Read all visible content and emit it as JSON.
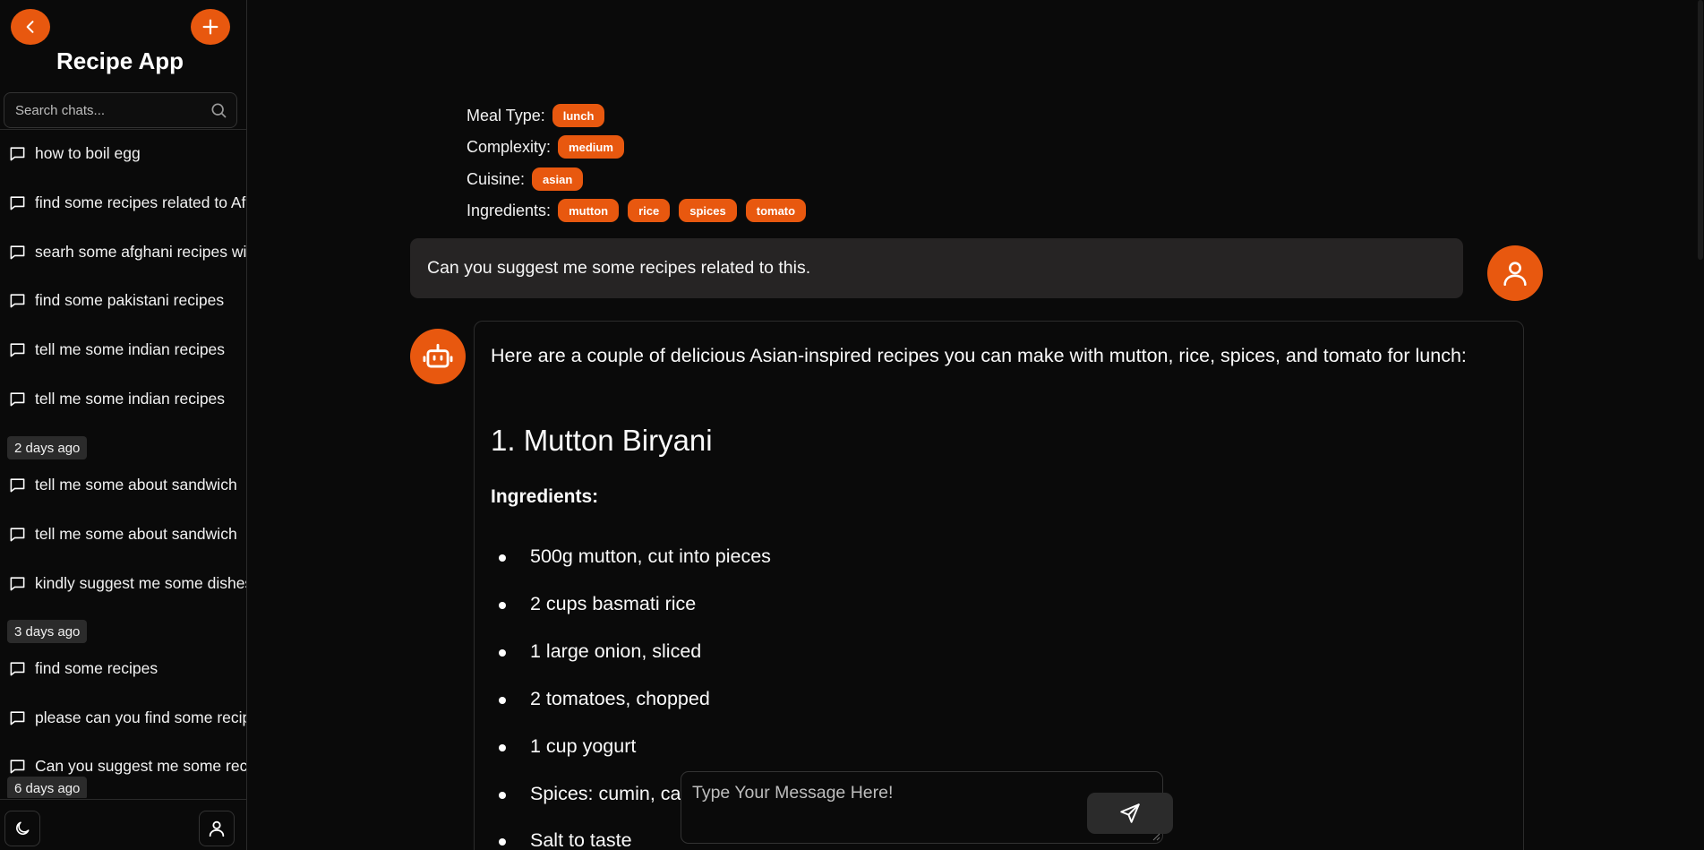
{
  "app": {
    "title": "Recipe App"
  },
  "search": {
    "placeholder": "Search chats..."
  },
  "chats": [
    {
      "label": "how to boil egg"
    },
    {
      "label": "find some recipes related to Af"
    },
    {
      "label": "searh some afghani recipes wit"
    },
    {
      "label": "find some pakistani recipes"
    },
    {
      "label": "tell me some indian recipes"
    },
    {
      "label": "tell me some indian recipes"
    },
    {
      "label": "tell me some about sandwich"
    },
    {
      "label": "tell me some about sandwich"
    },
    {
      "label": "kindly suggest me some dishes"
    },
    {
      "label": "find some recipes"
    },
    {
      "label": "please can you find some recip"
    },
    {
      "label": "Can you suggest me some reci"
    }
  ],
  "date_groups": [
    "2 days ago",
    "3 days ago",
    "6 days ago"
  ],
  "filters": {
    "meal_type": {
      "label": "Meal Type:",
      "values": [
        "lunch"
      ]
    },
    "complexity": {
      "label": "Complexity:",
      "values": [
        "medium"
      ]
    },
    "cuisine": {
      "label": "Cuisine:",
      "values": [
        "asian"
      ]
    },
    "ingredients": {
      "label": "Ingredients:",
      "values": [
        "mutton",
        "rice",
        "spices",
        "tomato"
      ]
    }
  },
  "user_message": "Can you suggest me some recipes related to this.",
  "bot_message": {
    "intro": "Here are a couple of delicious Asian-inspired recipes you can make with mutton, rice, spices, and tomato for lunch:",
    "recipe_title": "1. Mutton Biryani",
    "ingredients_heading": "Ingredients:",
    "ingredients": [
      "500g mutton, cut into pieces",
      "2 cups basmati rice",
      "1 large onion, sliced",
      "2 tomatoes, chopped",
      "1 cup yogurt",
      "Spices: cumin, car",
      "Salt to taste"
    ]
  },
  "composer": {
    "placeholder": "Type Your Message Here!"
  },
  "colors": {
    "accent": "#e8580f",
    "background": "#0a0a0a",
    "bubble": "#262424",
    "badge": "#2b2b2b"
  },
  "icons": {
    "back": "chevron-left-icon",
    "new_chat": "plus-icon",
    "search": "search-icon",
    "chat": "chat-bubble-icon",
    "theme": "moon-icon",
    "profile": "user-icon",
    "bot": "robot-icon",
    "send": "send-icon"
  }
}
